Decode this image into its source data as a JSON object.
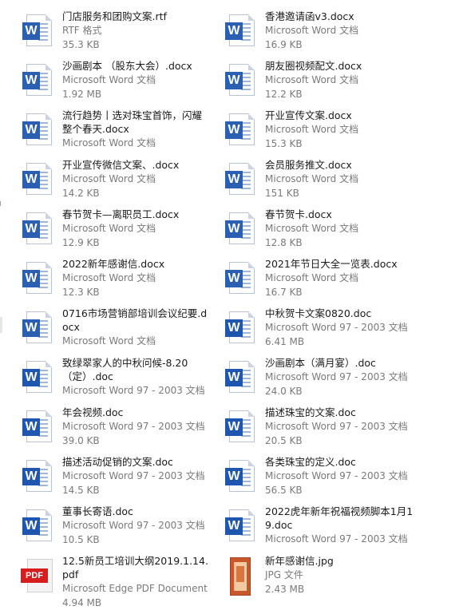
{
  "files": [
    {
      "name": "门店服务和团购文案.rtf",
      "type": "RTF 格式",
      "size": "35.3 KB",
      "icon": "word-icon"
    },
    {
      "name": "香港邀请函v3.docx",
      "type": "Microsoft Word 文档",
      "size": "16.9 KB",
      "icon": "word-icon"
    },
    {
      "name": "沙画剧本 （股东大会）.docx",
      "type": "Microsoft Word 文档",
      "size": "1.92 MB",
      "icon": "word-icon"
    },
    {
      "name": "朋友圈视频配文.docx",
      "type": "Microsoft Word 文档",
      "size": "12.2 KB",
      "icon": "word-icon"
    },
    {
      "name": "流行趋势丨选对珠宝首饰，闪耀整个春天.docx",
      "type": "Microsoft Word 文档",
      "size": "",
      "icon": "word-icon"
    },
    {
      "name": "开业宣传文案.docx",
      "type": "Microsoft Word 文档",
      "size": "15.3 KB",
      "icon": "word-icon"
    },
    {
      "name": "开业宣传微信文案、.docx",
      "type": "Microsoft Word 文档",
      "size": "14.2 KB",
      "icon": "word-icon"
    },
    {
      "name": "会员服务推文.docx",
      "type": "Microsoft Word 文档",
      "size": "151 KB",
      "icon": "word-icon"
    },
    {
      "name": "春节贺卡—离职员工.docx",
      "type": "Microsoft Word 文档",
      "size": "12.9 KB",
      "icon": "word-icon"
    },
    {
      "name": "春节贺卡.docx",
      "type": "Microsoft Word 文档",
      "size": "12.8 KB",
      "icon": "word-icon"
    },
    {
      "name": "2022新年感谢信.docx",
      "type": "Microsoft Word 文档",
      "size": "12.3 KB",
      "icon": "word-icon"
    },
    {
      "name": "2021年节日大全一览表.docx",
      "type": "Microsoft Word 文档",
      "size": "16.7 KB",
      "icon": "word-icon"
    },
    {
      "name": "0716市场营销部培训会议纪要.docx",
      "type": "Microsoft Word 文档",
      "size": "",
      "icon": "word-icon"
    },
    {
      "name": "中秋贺卡文案0820.doc",
      "type": "Microsoft Word 97 - 2003 文档",
      "size": "6.41 MB",
      "icon": "word-old-icon"
    },
    {
      "name": "致绿翠家人的中秋问候-8.20（定）.doc",
      "type": "Microsoft Word 97 - 2003 文档",
      "size": "",
      "icon": "word-old-icon"
    },
    {
      "name": "沙画剧本（满月宴）.doc",
      "type": "Microsoft Word 97 - 2003 文档",
      "size": "24.0 KB",
      "icon": "word-old-icon"
    },
    {
      "name": "年会视频.doc",
      "type": "Microsoft Word 97 - 2003 文档",
      "size": "39.0 KB",
      "icon": "word-old-icon"
    },
    {
      "name": "描述珠宝的文案.doc",
      "type": "Microsoft Word 97 - 2003 文档",
      "size": "20.5 KB",
      "icon": "word-old-icon"
    },
    {
      "name": "描述活动促销的文案.doc",
      "type": "Microsoft Word 97 - 2003 文档",
      "size": "14.5 KB",
      "icon": "word-old-icon"
    },
    {
      "name": "各类珠宝的定义.doc",
      "type": "Microsoft Word 97 - 2003 文档",
      "size": "56.5 KB",
      "icon": "word-old-icon"
    },
    {
      "name": "董事长寄语.doc",
      "type": "Microsoft Word 97 - 2003 文档",
      "size": "10.5 KB",
      "icon": "word-old-icon"
    },
    {
      "name": "2022虎年新年祝福视频脚本1月19.doc",
      "type": "Microsoft Word 97 - 2003 文档",
      "size": "",
      "icon": "word-old-icon"
    },
    {
      "name": "12.5新员工培训大纲2019.1.14.pdf",
      "type": "Microsoft Edge PDF Document",
      "size": "4.94 MB",
      "icon": "pdf-icon"
    },
    {
      "name": "新年感谢信.jpg",
      "type": "JPG 文件",
      "size": "2.43 MB",
      "icon": "jpg-thumbnail-icon"
    }
  ],
  "labels": {
    "word_letter": "W",
    "pdf_label": "PDF"
  }
}
